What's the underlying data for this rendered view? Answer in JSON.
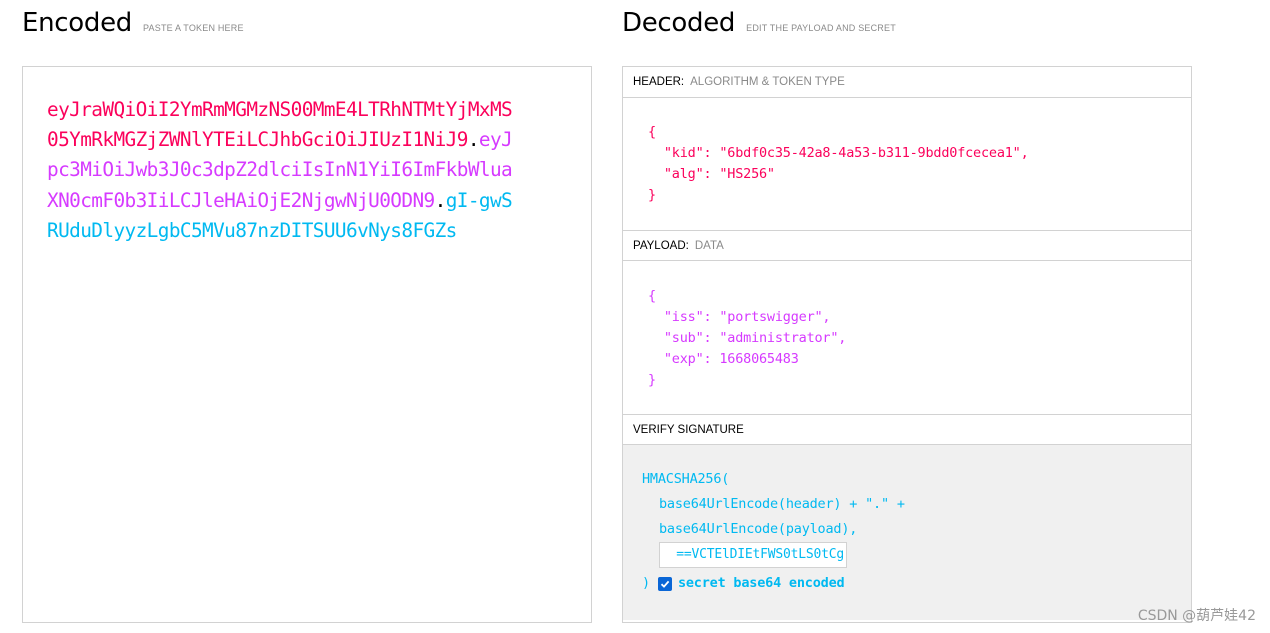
{
  "encoded": {
    "title": "Encoded",
    "hint": "PASTE A TOKEN HERE",
    "token_header": "eyJraWQiOiI2YmRmMGMzNS00MmE4LTRhNTMtYjMxMS05YmRkMGZjZWNlYTEiLCJhbGciOiJIUzI1NiJ9",
    "dot1": ".",
    "token_payload": "eyJpc3MiOiJwb3J0c3dpZ2dlciIsInN1YiI6ImFkbWluaXN0cmF0b3IiLCJleHAiOjE2NjgwNjU0ODN9",
    "dot2": ".",
    "token_signature": "gI-gwSRUduDlyyzLgbC5MVu87nzDITSUU6vNys8FGZs"
  },
  "decoded": {
    "title": "Decoded",
    "hint": "EDIT THE PAYLOAD AND SECRET",
    "header_section": {
      "label": "HEADER:",
      "sub": "ALGORITHM & TOKEN TYPE"
    },
    "header_json": {
      "open": "{",
      "kid_key": "\"kid\"",
      "kid_value": "\"6bdf0c35-42a8-4a53-b311-9bdd0fcecea1\"",
      "alg_key": "\"alg\"",
      "alg_value": "\"HS256\"",
      "close": "}"
    },
    "payload_section": {
      "label": "PAYLOAD:",
      "sub": "DATA"
    },
    "payload_json": {
      "open": "{",
      "iss_key": "\"iss\"",
      "iss_value": "\"portswigger\"",
      "sub_key": "\"sub\"",
      "sub_value": "\"administrator\"",
      "exp_key": "\"exp\"",
      "exp_value": "1668065483",
      "close": "}"
    },
    "verify_section": {
      "label": "VERIFY SIGNATURE"
    },
    "verify": {
      "line1": "HMACSHA256(",
      "line2": "base64UrlEncode(header) + \".\" +",
      "line3": "base64UrlEncode(payload),",
      "secret_value": "VCTElDIEtFWS0tLS0tCg==",
      "close": ")",
      "checkbox_label": "secret base64 encoded",
      "checkbox_checked": true
    }
  },
  "watermark": "CSDN @葫芦娃42",
  "colors": {
    "header": "#fb015b",
    "payload": "#d63aff",
    "signature": "#00b9f1",
    "checkbox": "#0a66d6"
  }
}
